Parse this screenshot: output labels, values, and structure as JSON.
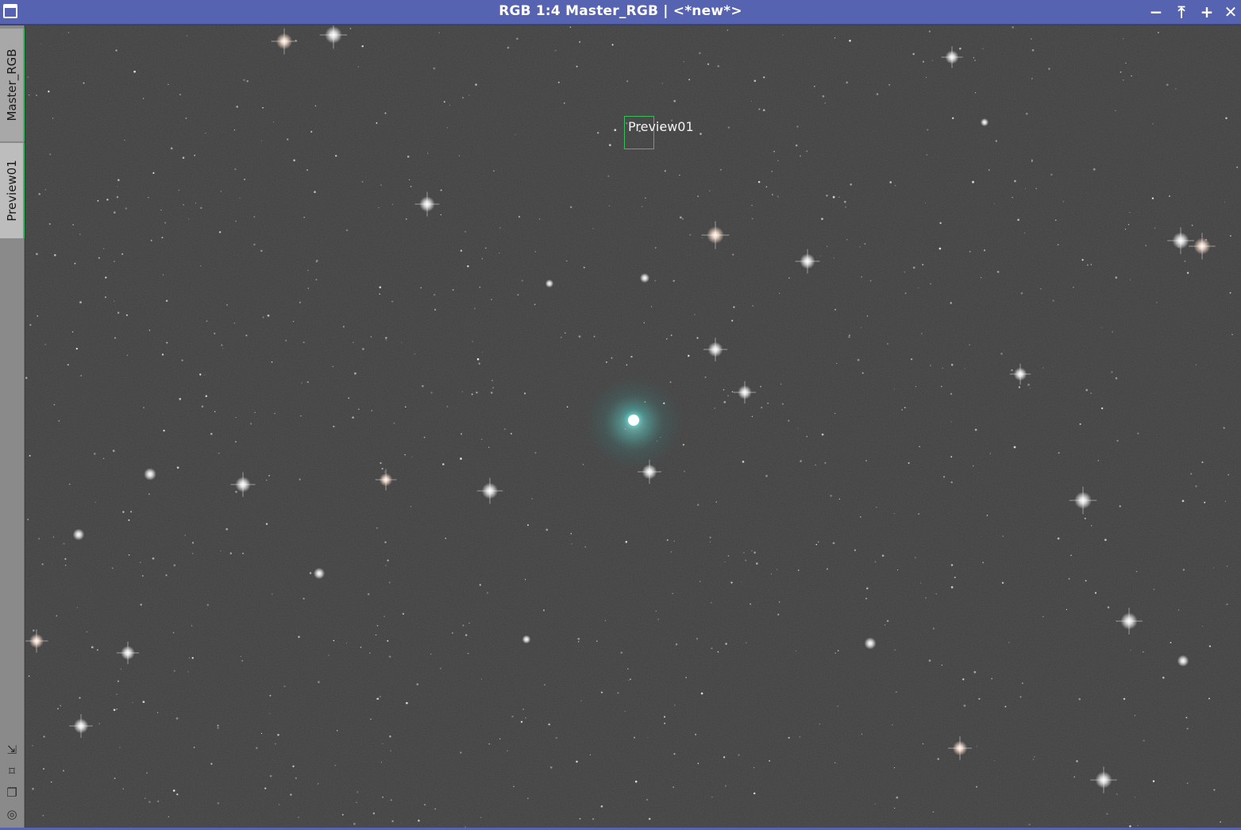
{
  "window": {
    "title": "RGB 1:4 Master_RGB | <*new*>",
    "title_bar_color": "#5563b0",
    "controls": [
      {
        "name": "shade-button",
        "glyph": "−"
      },
      {
        "name": "maximize-button",
        "glyph": "⤒"
      },
      {
        "name": "zoom-button",
        "glyph": "+"
      },
      {
        "name": "close-button",
        "glyph": "✕"
      }
    ]
  },
  "tabs": [
    {
      "label": "Master_RGB"
    },
    {
      "label": "Preview01"
    }
  ],
  "side_tools": [
    {
      "icon": "shrink-arrow-icon",
      "glyph": "⇲"
    },
    {
      "icon": "fit-view-icon",
      "glyph": "⌑"
    },
    {
      "icon": "clone-icon",
      "glyph": "❐"
    },
    {
      "icon": "target-icon",
      "glyph": "◎"
    }
  ],
  "image": {
    "preview_label": "Preview01",
    "preview_border_color": "#3bbf5a",
    "nebula_color": "#5fd8d0"
  }
}
